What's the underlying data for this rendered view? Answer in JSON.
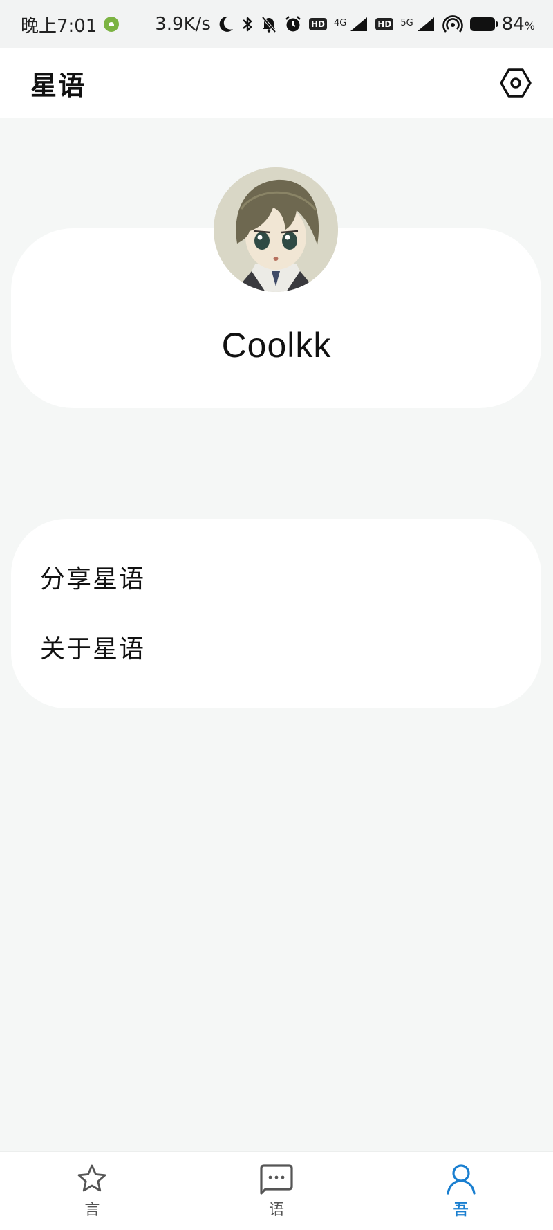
{
  "status_bar": {
    "time": "晚上7:01",
    "net_speed": "3.9K/s",
    "network_4g": "4G",
    "network_5g": "5G",
    "battery_percent": "84",
    "battery_unit": "%"
  },
  "app_bar": {
    "title": "星语"
  },
  "profile": {
    "username": "Coolkk"
  },
  "menu": {
    "items": [
      {
        "label": "分享星语"
      },
      {
        "label": "关于星语"
      }
    ]
  },
  "bottom_nav": {
    "items": [
      {
        "label": "言",
        "icon": "star-icon",
        "active": false
      },
      {
        "label": "语",
        "icon": "message-icon",
        "active": false
      },
      {
        "label": "吾",
        "icon": "person-icon",
        "active": true
      }
    ]
  },
  "colors": {
    "accent": "#1a7fd0",
    "background": "#f5f7f6",
    "card": "#ffffff"
  }
}
